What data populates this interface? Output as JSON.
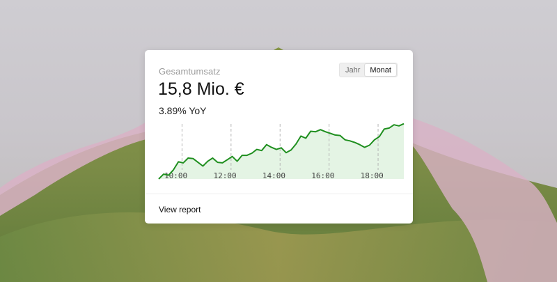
{
  "card": {
    "title": "Gesamtumsatz",
    "value": "15,8 Mio. €",
    "delta": "3.89% YoY",
    "toggle": {
      "options": [
        "Jahr",
        "Monat"
      ],
      "selected": "Monat"
    },
    "footer_link": "View report"
  },
  "colors": {
    "line": "#1f8f1f",
    "fill": "#e4f4e4",
    "grid": "#b5b5b5"
  },
  "chart_data": {
    "type": "area",
    "x_ticks": [
      {
        "label": "10:00",
        "x": 10
      },
      {
        "label": "12:00",
        "x": 12
      },
      {
        "label": "14:00",
        "x": 14
      },
      {
        "label": "16:00",
        "x": 16
      },
      {
        "label": "18:00",
        "x": 18
      }
    ],
    "xlim": [
      9.3,
      19.3
    ],
    "ylim": [
      0,
      10
    ],
    "grid": "dashed vertical",
    "series": [
      {
        "x": [
          9.3,
          9.5,
          9.7,
          9.9,
          10.1,
          10.3,
          10.5,
          10.7,
          10.9,
          11.1,
          11.3,
          11.5,
          11.7,
          11.9,
          12.1,
          12.3,
          12.5,
          12.7,
          12.9,
          13.1,
          13.3,
          13.5,
          13.7,
          13.9,
          14.1,
          14.3,
          14.5,
          14.7,
          14.9,
          15.1,
          15.3,
          15.5,
          15.7,
          15.9,
          16.1,
          16.3,
          16.5,
          16.7,
          16.9,
          17.1,
          17.3,
          17.5,
          17.7,
          17.9,
          18.1,
          18.3,
          18.5,
          18.7,
          18.9,
          19.1,
          19.3
        ],
        "values": [
          0,
          0.9,
          0.7,
          1.7,
          3.2,
          3.0,
          3.9,
          3.8,
          3.1,
          2.4,
          3.3,
          3.9,
          3.1,
          3.0,
          3.6,
          4.2,
          3.3,
          4.4,
          4.4,
          4.8,
          5.5,
          5.3,
          6.4,
          5.9,
          5.5,
          5.8,
          4.9,
          5.4,
          6.5,
          8.0,
          7.6,
          8.9,
          8.8,
          9.2,
          8.8,
          8.5,
          8.2,
          8.1,
          7.3,
          7.1,
          6.8,
          6.4,
          5.9,
          6.3,
          7.3,
          7.9,
          9.3,
          9.5,
          10.1,
          9.9,
          10.3
        ]
      }
    ]
  }
}
